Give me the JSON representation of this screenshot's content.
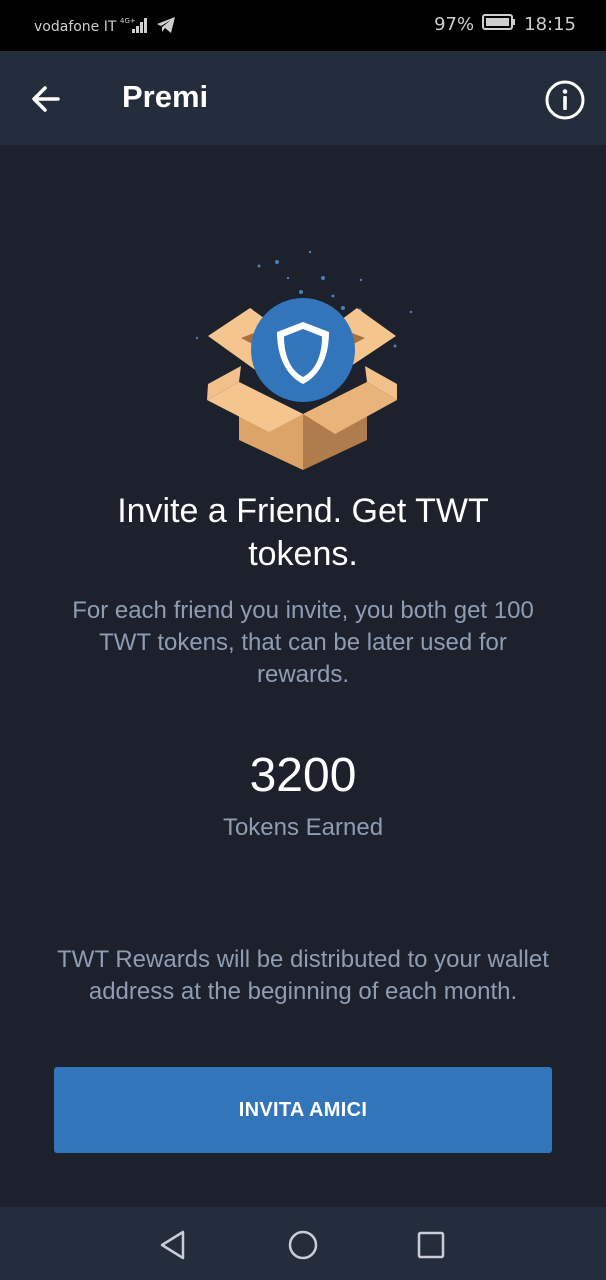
{
  "status_bar": {
    "carrier": "vodafone IT",
    "network": "4G+",
    "battery_percent": "97%",
    "time": "18:15"
  },
  "app_bar": {
    "title": "Premi",
    "back_icon": "arrow-left-icon",
    "info_icon": "info-circle-icon"
  },
  "hero": {
    "illustration": "open-box-shield-illustration"
  },
  "main": {
    "headline": "Invite a Friend. Get TWT tokens.",
    "subtext": "For each friend you invite, you both get 100 TWT tokens, that can be later used for rewards.",
    "token_count": "3200",
    "token_label": "Tokens Earned",
    "rewards_note": "TWT Rewards will be distributed to your wallet address at the beginning of each month."
  },
  "invite_button": {
    "label": "INVITA AMICI"
  },
  "colors": {
    "background": "#1c212c",
    "app_bar": "#242d3c",
    "accent": "#3375bb",
    "muted_text": "#8f9db3"
  }
}
